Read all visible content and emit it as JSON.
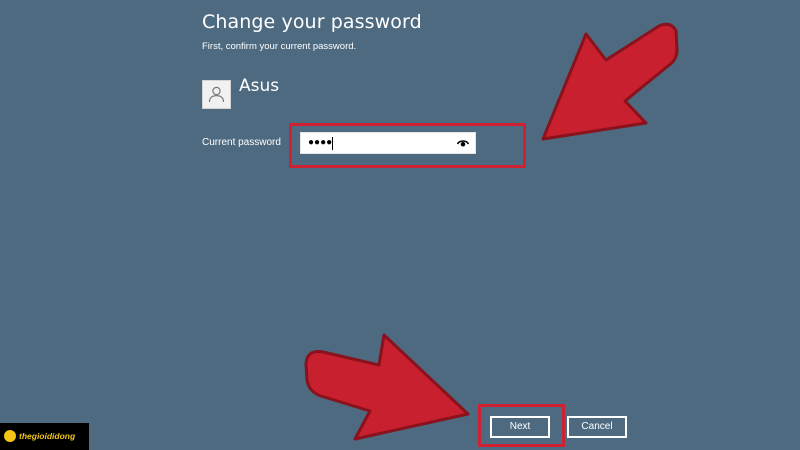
{
  "dialog": {
    "title": "Change your password",
    "subtitle": "First, confirm your current password.",
    "user": {
      "name": "Asus",
      "avatar_icon": "user-silhouette-icon"
    },
    "password": {
      "label": "Current password",
      "masked_value": "●●●●",
      "reveal_icon": "eye-icon"
    },
    "buttons": {
      "next_label": "Next",
      "cancel_label": "Cancel"
    }
  },
  "annotations": {
    "highlight_color": "#d02033",
    "arrow_color": "#d02033"
  },
  "watermark": {
    "brand_text": "thegioididong",
    "brand_color": "#f5c518"
  },
  "colors": {
    "background": "#4d6a80",
    "foreground": "#ffffff"
  }
}
